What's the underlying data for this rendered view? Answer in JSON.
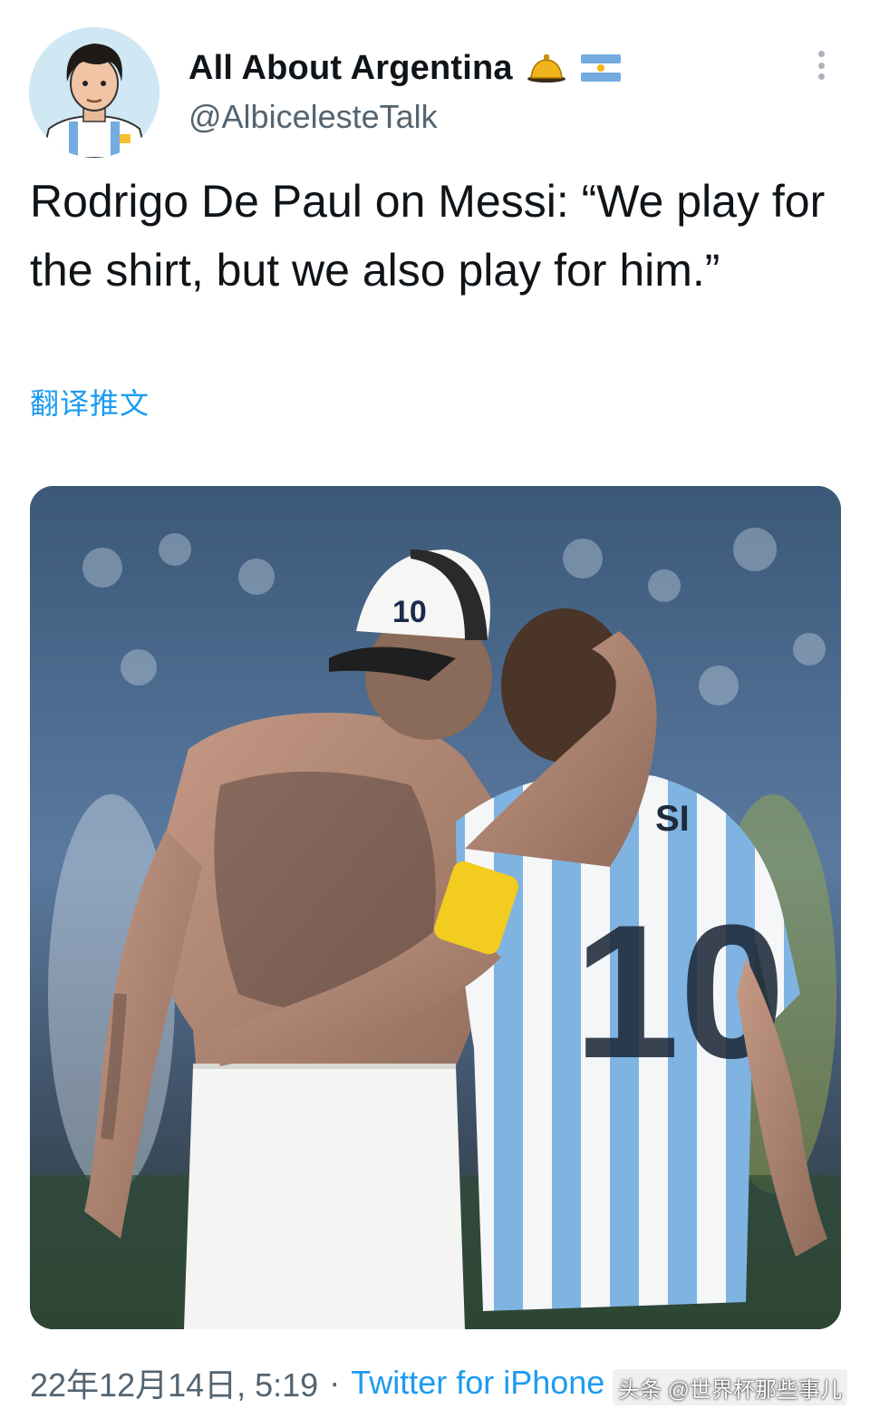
{
  "tweet": {
    "author": {
      "display_name": "All About Argentina",
      "handle": "@AlbicelesteTalk",
      "badges": [
        "bell-emoji",
        "argentina-flag-emoji"
      ]
    },
    "text": "Rodrigo De Paul on Messi: “We play for the shirt, but we also play for him.”",
    "translate_label": "翻译推文",
    "media_alt": "photo",
    "timestamp": "22年12月14日, 5:19",
    "separator": "·",
    "source": "Twitter for iPhone",
    "more_icon": "more-options-icon"
  },
  "watermark": {
    "text": "头条 @世界杯那些事儿"
  },
  "colors": {
    "text_primary": "#0f1419",
    "text_secondary": "#536471",
    "link": "#1d9bf0",
    "argentina_blue": "#74acdf"
  }
}
